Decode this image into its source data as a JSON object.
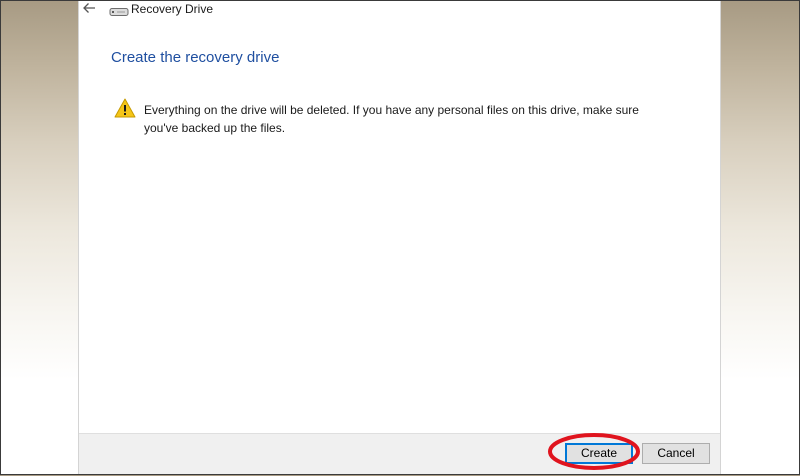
{
  "window": {
    "title": "Recovery Drive",
    "back_icon": "back-arrow-icon",
    "app_icon": "drive-icon"
  },
  "page": {
    "heading": "Create the recovery drive",
    "warning_icon": "warning-icon",
    "warning_text": "Everything on the drive will be deleted. If you have any personal files on this drive, make sure you've backed up the files."
  },
  "footer": {
    "create_label": "Create",
    "cancel_label": "Cancel"
  },
  "colors": {
    "heading": "#1f4fa0",
    "highlight": "#e0141e",
    "warning": "#f5c518",
    "focus_border": "#0078d7"
  }
}
